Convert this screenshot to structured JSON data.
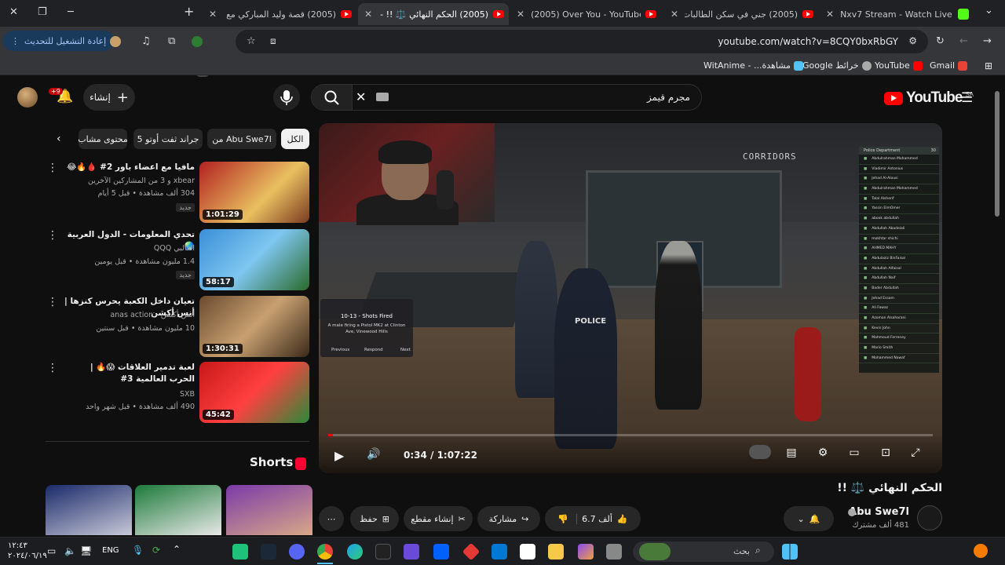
{
  "browser": {
    "tabs": [
      {
        "title": "Nxv7 Stream - Watch Live on Ki"
      },
      {
        "title": "(2005) جني في سكن الطالبات |"
      },
      {
        "title": "(2005) Over You - YouTube"
      },
      {
        "title": "(2005) الحكم النهائي ⚖️ !! - Tube"
      },
      {
        "title": "(2005) قصة وليد المباركي مع داد"
      }
    ],
    "new_tab": "+",
    "url": "youtube.com/watch?v=8CQY0bxRbGY",
    "update_button": "إعادة التشغيل للتحديث",
    "extension_badge": "49",
    "bookmarks": [
      "Gmail",
      "YouTube",
      "Google خرائط",
      "مشاهدة... - WitAnime"
    ]
  },
  "header": {
    "search_query": "مجرم قيمز",
    "create_label": "إنشاء",
    "notifications_badge": "+9",
    "logo_text": "YouTube",
    "logo_region": "SA"
  },
  "player": {
    "current_time": "0:34",
    "duration": "1:07:22",
    "time_display": "0:34 / 1:07:22",
    "progress_fraction": 0.0084,
    "scene_sign": "CORRIDORS",
    "police_text": "POLICE",
    "notification": {
      "header": "10-13 - Shots Fired",
      "body": "A male firing a Pistol MK2 at Clinton Ave, Vinewood Hills",
      "buttons": [
        "Previous",
        "Respond",
        "Next"
      ]
    },
    "pd_list": {
      "title": "Police Department",
      "count": "30",
      "members": [
        "Abdulrahman Mohammed",
        "Vladimir Antonius",
        "Jehad Al-Alousi",
        "Abdulrahman Mohammed",
        "Talal Alsherif",
        "Yassin ElmOmer",
        "abook abdullah",
        "Abdullah Abadeiali",
        "mokhtar shichi",
        "AHMED MAHY",
        "Abdulaziz BinFaisal",
        "Abdullah Alfaisal",
        "Abdullah Naif",
        "Bader Abdullah",
        "Jehad Essam",
        "Ali Fawaz",
        "Azoman Alsaharani",
        "Kevin John",
        "Mahmoud Ferreney",
        "Mario Smith",
        "Mohammed Nawaf"
      ]
    }
  },
  "video": {
    "title": "الحكم النهائي ⚖️ !!",
    "channel": "Abu Swe7l",
    "subscribers": "481 ألف مشترك",
    "likes": "6.7 ألف",
    "share": "مشاركة",
    "clip": "إنشاء مقطع",
    "save": "حفظ",
    "more": "⋯"
  },
  "chips": [
    {
      "label": "الكل",
      "active": true
    },
    {
      "label": "من Abu Swe7l",
      "active": false
    },
    {
      "label": "جراند ثفت أوتو 5",
      "active": false
    },
    {
      "label": "محتوى مشاب",
      "active": false
    }
  ],
  "recommendations": [
    {
      "title": "مافيا مع اعضاء باور 2# 🩸🔥😂",
      "channel": "xbear و 3 من المشاركين الآخرين",
      "meta": "304 ألف مشاهدة • قبل 5 أيام",
      "badge": "جديد",
      "duration": "1:01:29"
    },
    {
      "title": "تحدي المعلومات - الدول العربية 🌏",
      "channel": "الغالبي QQQ",
      "meta": "1.4 مليون مشاهدة • قبل يومين",
      "badge": "جديد",
      "duration": "58:17"
    },
    {
      "title": "تعيان داخل الكعبة يحرس كنزها | أنس أكشن",
      "channel": "أنس أكشن - anas action",
      "meta": "10 مليون مشاهدة • قبل سنتين",
      "badge": "",
      "duration": "1:30:31"
    },
    {
      "title": "لعبة تدمير العلاقات 😱🔥 | الحرب العالمية 3#",
      "channel": "SXB",
      "meta": "490 ألف مشاهدة • قبل شهر واحد",
      "badge": "",
      "duration": "45:42"
    }
  ],
  "shorts_label": "Shorts",
  "taskbar": {
    "search": "بحث",
    "lang": "ENG",
    "time": "١٢:٤٣",
    "date": "٢٠٢٤/٠٦/١٩"
  }
}
